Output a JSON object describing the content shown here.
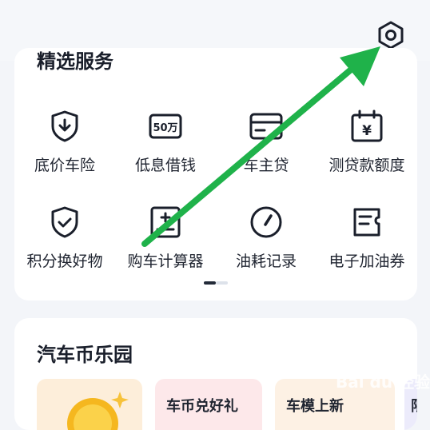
{
  "section": {
    "title": "精选服务"
  },
  "services": [
    {
      "label": "底价车险",
      "icon": "shield-download-icon"
    },
    {
      "label": "低息借钱",
      "icon": "50wan-icon"
    },
    {
      "label": "车主贷",
      "icon": "card-icon"
    },
    {
      "label": "测贷款额度",
      "icon": "calendar-yuan-icon"
    },
    {
      "label": "积分换好物",
      "icon": "shield-check-icon"
    },
    {
      "label": "购车计算器",
      "icon": "calculator-icon"
    },
    {
      "label": "油耗记录",
      "icon": "gauge-icon"
    },
    {
      "label": "电子加油券",
      "icon": "coupon-icon"
    }
  ],
  "icon_50": "50万",
  "icon_yuan": "¥",
  "paradise": {
    "title": "汽车币乐园",
    "promos": [
      "车币兑好礼",
      "车模上新",
      "限"
    ]
  },
  "watermark": "Bai du 经验",
  "colors": {
    "accent_arrow": "#1fb24a",
    "text": "#1a1f2b",
    "card": "#ffffff"
  }
}
